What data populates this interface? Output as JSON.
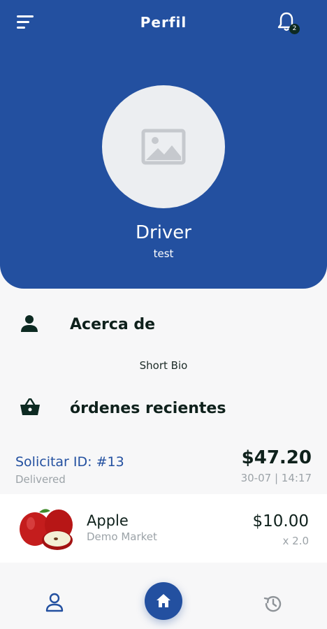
{
  "header": {
    "title": "Perfil",
    "menu_icon": "menu-icon",
    "notification_icon": "bell-icon",
    "notification_count": "2",
    "background_color": "#2350a0"
  },
  "profile": {
    "avatar_icon": "image-placeholder-icon",
    "name": "Driver",
    "subtitle": "test"
  },
  "about": {
    "icon": "person-icon",
    "title": "Acerca de",
    "bio": "Short Bio"
  },
  "orders": {
    "icon": "basket-icon",
    "title": "órdenes recientes",
    "items": [
      {
        "id_label": "Solicitar ID: #13",
        "status": "Delivered",
        "total": "$47.20",
        "date": "30-07 | 14:17",
        "products": [
          {
            "name": "Apple",
            "market": "Demo Market",
            "price": "$10.00",
            "quantity": "x 2.0",
            "image": "apple-image"
          }
        ]
      }
    ]
  },
  "bottom_nav": {
    "items": [
      "profile-icon",
      "home-icon",
      "history-icon"
    ],
    "active": "home-icon",
    "accent_color": "#2350a0"
  }
}
